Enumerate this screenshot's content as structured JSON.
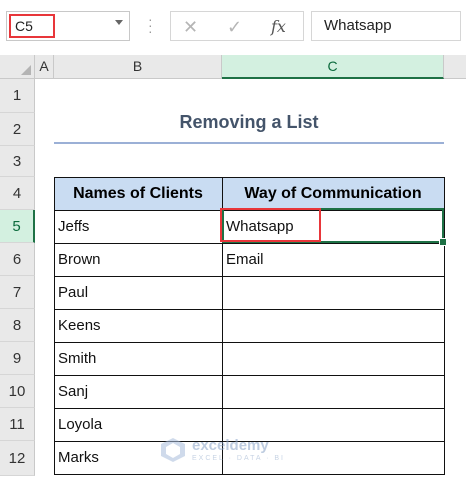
{
  "formula_bar": {
    "name_box": "C5",
    "cancel_glyph": "✕",
    "enter_glyph": "✓",
    "fx_label": "fx",
    "content": "Whatsapp"
  },
  "columns": [
    "A",
    "B",
    "C"
  ],
  "rows": [
    "1",
    "2",
    "3",
    "4",
    "5",
    "6",
    "7",
    "8",
    "9",
    "10",
    "11",
    "12"
  ],
  "sheet": {
    "title": "Removing a List",
    "table": {
      "headers": [
        "Names of Clients",
        "Way of Communication"
      ],
      "rows": [
        [
          "Jeffs",
          "Whatsapp"
        ],
        [
          "Brown",
          "Email"
        ],
        [
          "Paul",
          ""
        ],
        [
          "Keens",
          ""
        ],
        [
          "Smith",
          ""
        ],
        [
          "Sanj",
          ""
        ],
        [
          "Loyola",
          ""
        ],
        [
          "Marks",
          ""
        ]
      ]
    }
  },
  "watermark": {
    "name": "exceldemy",
    "tagline": "EXCEL · DATA · BI"
  },
  "colors": {
    "header_fill": "#c9dcf2",
    "title_text": "#44546a",
    "selection_green": "#1e7145",
    "highlight_red": "#e8363a"
  }
}
